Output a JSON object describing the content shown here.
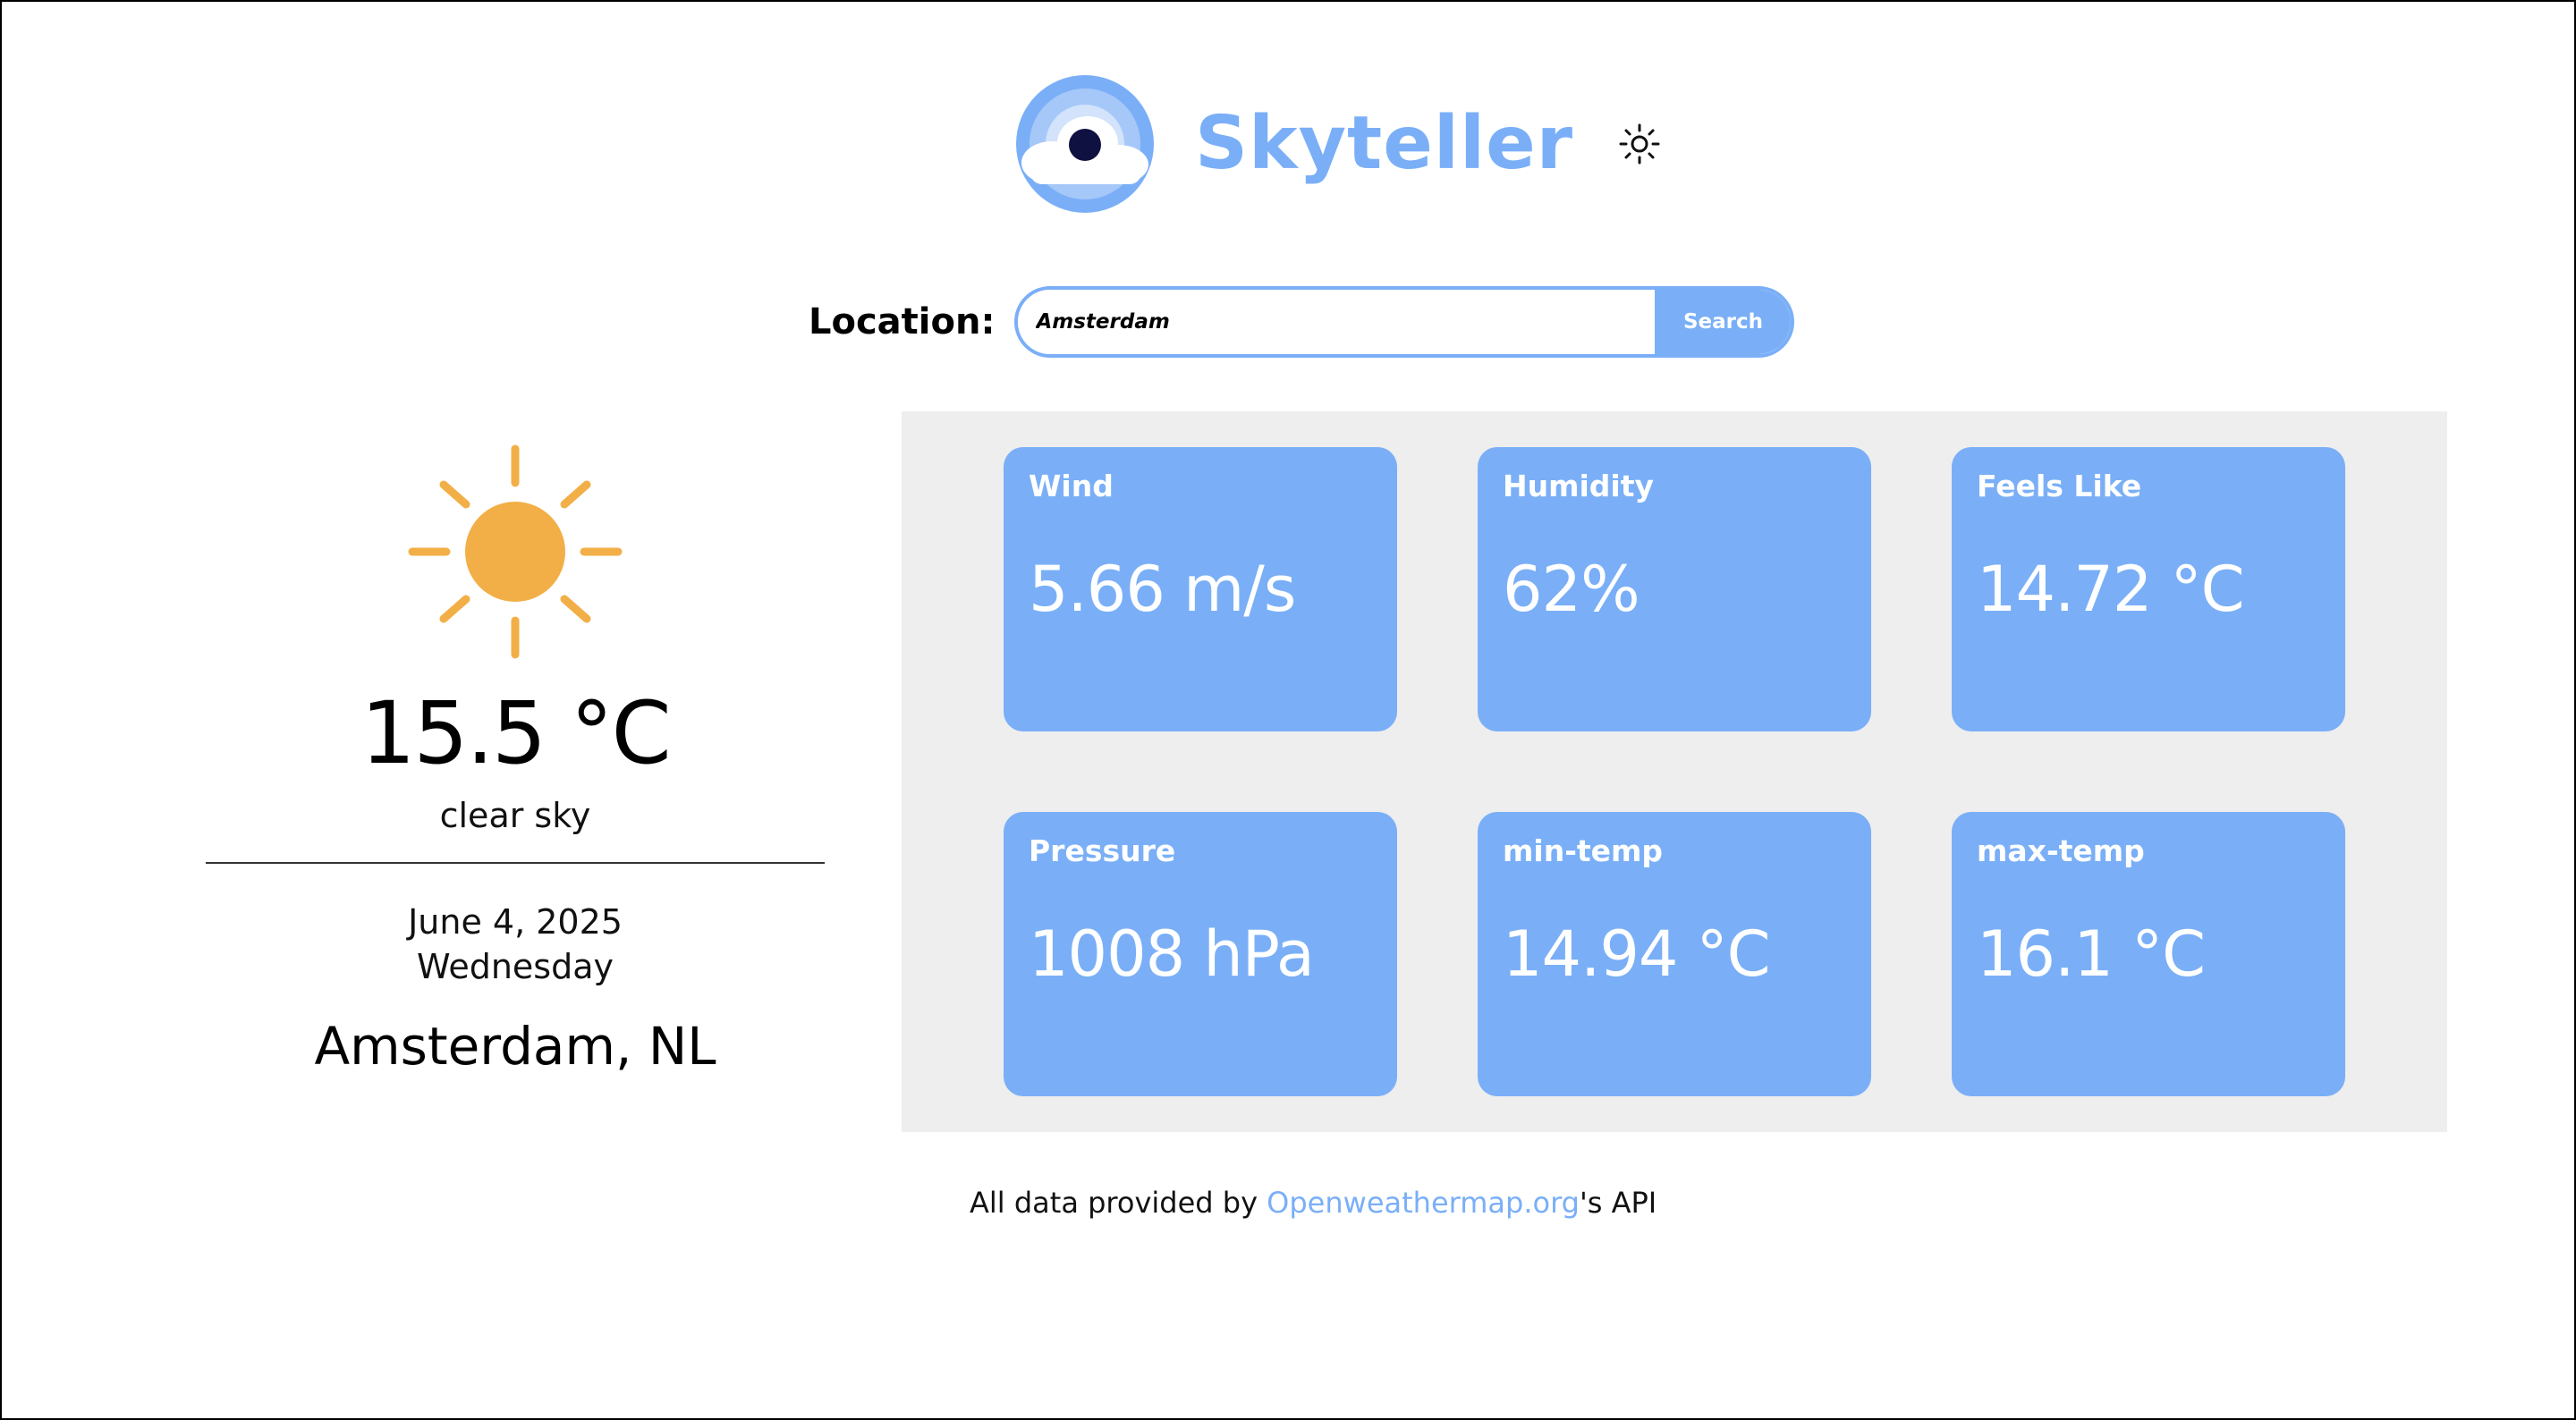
{
  "header": {
    "app_title": "Skyteller",
    "logo_icon": "cloud-eye-logo",
    "theme_toggle_icon": "sun-outline-icon"
  },
  "search": {
    "label": "Location:",
    "value": "Amsterdam",
    "button_label": "Search"
  },
  "current": {
    "icon": "sun-icon",
    "temperature": "15.5 °C",
    "condition": "clear sky",
    "date": "June 4, 2025",
    "weekday": "Wednesday",
    "city": "Amsterdam, NL"
  },
  "stats": [
    {
      "title": "Wind",
      "value": "5.66 m/s"
    },
    {
      "title": "Humidity",
      "value": "62%"
    },
    {
      "title": "Feels Like",
      "value": "14.72 °C"
    },
    {
      "title": "Pressure",
      "value": "1008 hPa"
    },
    {
      "title": "min-temp",
      "value": "14.94 °C"
    },
    {
      "title": "max-temp",
      "value": "16.1 °C"
    }
  ],
  "footer": {
    "prefix": "All data provided by ",
    "link_text": "Openweathermap.org",
    "suffix": "'s API"
  },
  "colors": {
    "accent": "#7aaff7",
    "sun": "#f2af47",
    "panel_bg": "#eeeeee",
    "logo_dark": "#0f1140"
  }
}
